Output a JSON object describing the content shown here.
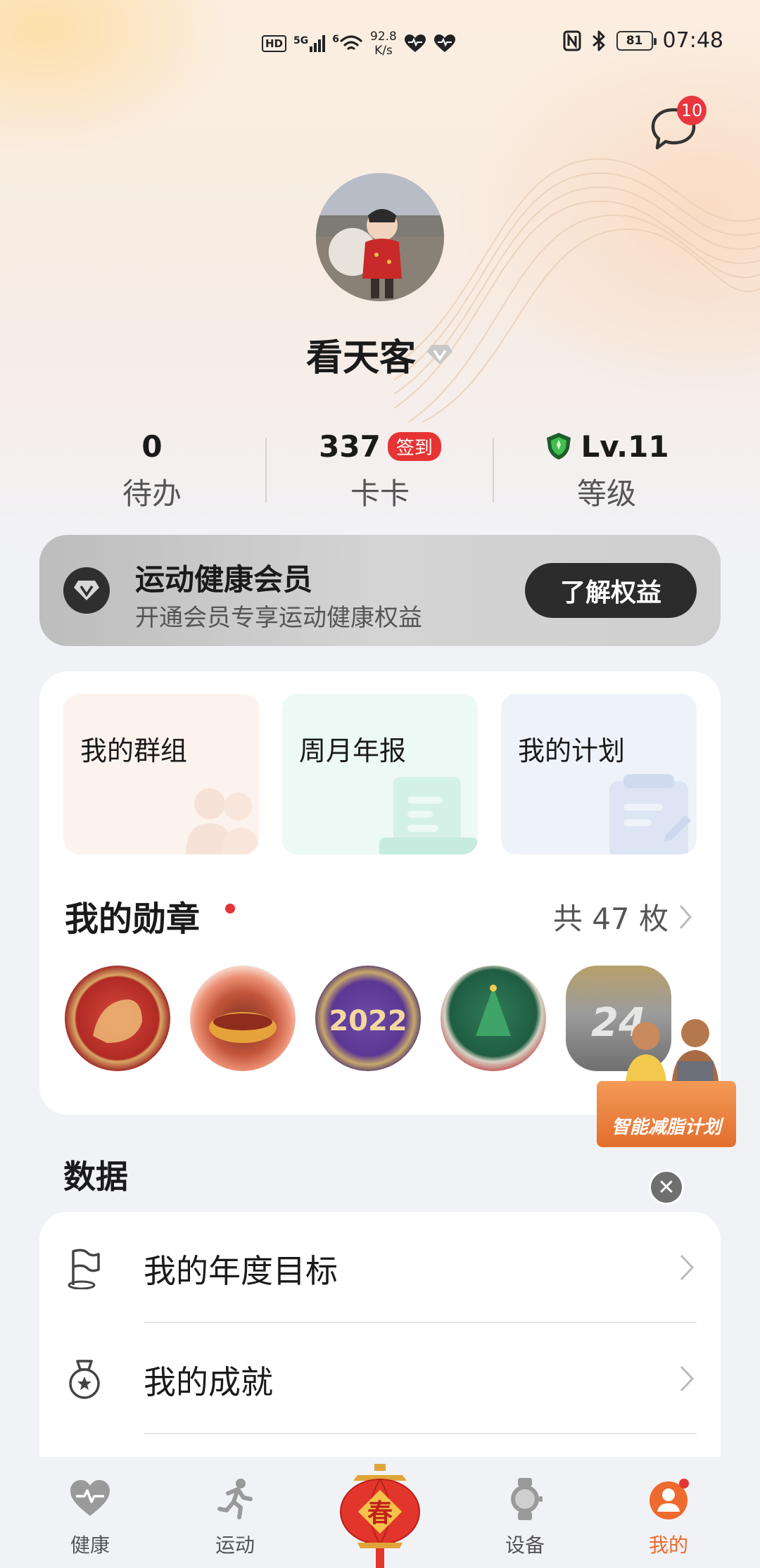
{
  "status_bar": {
    "hd": "HD",
    "signal": "5G",
    "wifi_gen": "6",
    "speed_value": "92.8",
    "speed_unit": "K/s",
    "battery": "81",
    "time": "07:48"
  },
  "header": {
    "message_badge": "10"
  },
  "profile": {
    "name": "看天客"
  },
  "stats": {
    "todo_value": "0",
    "todo_label": "待办",
    "card_value": "337",
    "checkin_label": "签到",
    "card_label": "卡卡",
    "level_value": "Lv.11",
    "level_label": "等级"
  },
  "membership": {
    "title": "运动健康会员",
    "subtitle": "开通会员专享运动健康权益",
    "button": "了解权益"
  },
  "quick_tiles": [
    {
      "label": "我的群组"
    },
    {
      "label": "周月年报"
    },
    {
      "label": "我的计划"
    }
  ],
  "medals": {
    "title": "我的勋章",
    "count": "共 47 枚"
  },
  "promo": {
    "label": "智能减脂计划"
  },
  "data_section": {
    "title": "数据",
    "rows": [
      {
        "label": "我的年度目标"
      },
      {
        "label": "我的成就"
      }
    ]
  },
  "bottom_nav": {
    "items": [
      {
        "label": "健康"
      },
      {
        "label": "运动"
      },
      {
        "label": "春"
      },
      {
        "label": "设备"
      },
      {
        "label": "我的"
      }
    ]
  },
  "colors": {
    "accent": "#ee6a2e",
    "badge_red": "#e63434",
    "level_shield": "#2e9d3a"
  }
}
